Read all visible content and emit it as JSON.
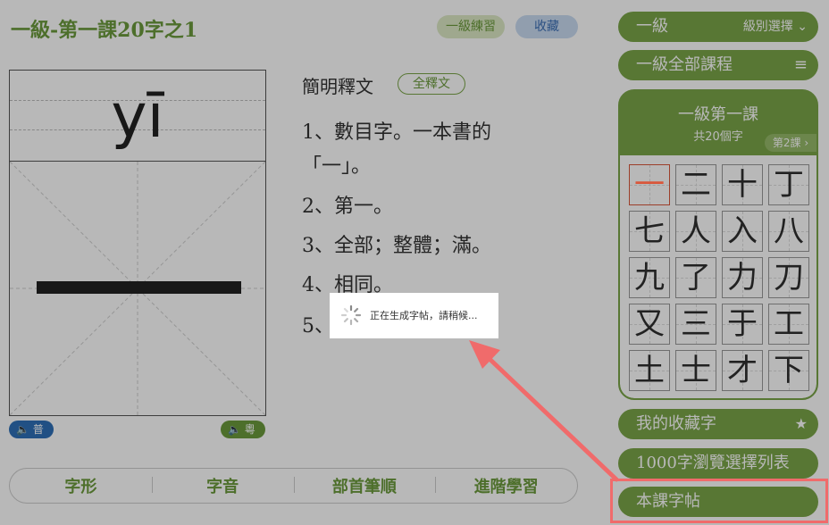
{
  "header": {
    "title": "一級-第一課20字之1",
    "practice_label": "一級練習",
    "favorite_label": "收藏"
  },
  "card": {
    "pinyin": "yī",
    "audio_mandarin": "普",
    "audio_cantonese": "粵"
  },
  "definition": {
    "heading": "簡明釋文",
    "full_label": "全釋文",
    "lines": [
      "1、數目字。一本書的",
      "「一」。",
      "2、第一。",
      "3、全部；整體；滿。",
      "4、相同。",
      "5、"
    ]
  },
  "bottom_tabs": [
    "字形",
    "字音",
    "部首筆順",
    "進階學習"
  ],
  "sidebar": {
    "level_label": "一級",
    "level_select": "級別選擇",
    "all_courses": "一級全部課程",
    "lesson_title": "一級第一課",
    "lesson_count": "共20個字",
    "page_label": "第2課",
    "chars": [
      "一",
      "二",
      "十",
      "丁",
      "七",
      "人",
      "入",
      "八",
      "九",
      "了",
      "力",
      "刀",
      "又",
      "三",
      "于",
      "工",
      "土",
      "士",
      "才",
      "下"
    ],
    "favorites": "我的收藏字",
    "browse_list": "1000字瀏覽選擇列表",
    "copybook": "本課字帖"
  },
  "loading": {
    "message": "正在生成字帖，請稍候..."
  },
  "colors": {
    "green": "#7aa548",
    "blue": "#2f6fb7",
    "highlight": "#f06b6b",
    "active_char": "#d9573b"
  }
}
